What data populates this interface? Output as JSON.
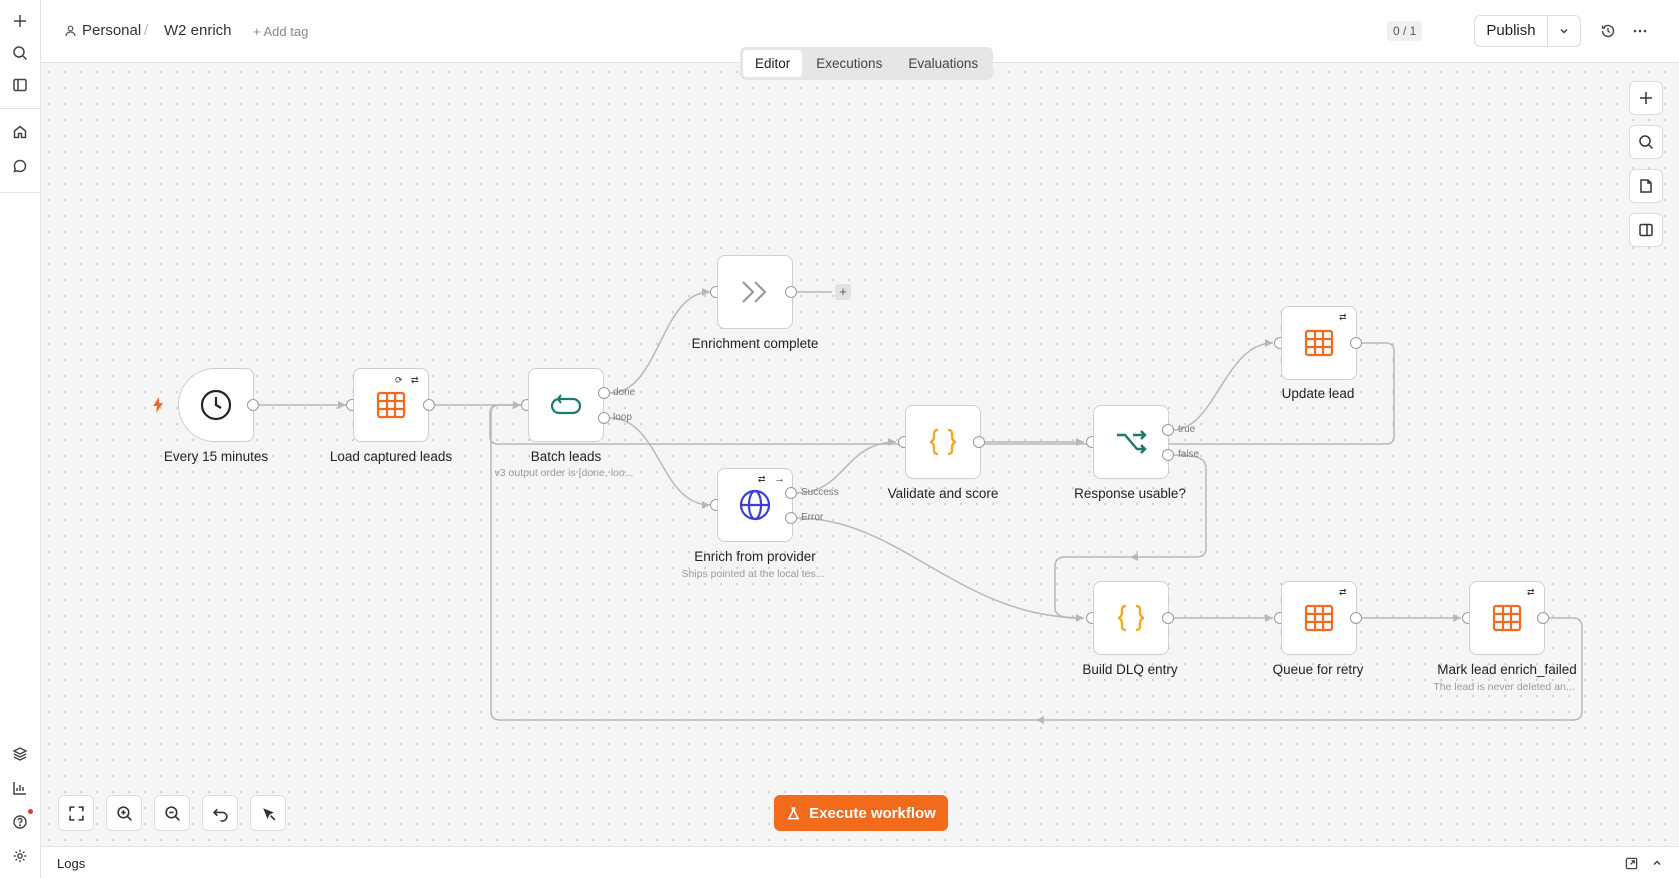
{
  "breadcrumb": {
    "project": "Personal",
    "separator": "/",
    "workflow": "W2 enrich",
    "add_tag": "+ Add tag"
  },
  "header": {
    "counter": "0 / 1",
    "publish": "Publish"
  },
  "tabs": [
    {
      "label": "Editor",
      "active": true
    },
    {
      "label": "Executions",
      "active": false
    },
    {
      "label": "Evaluations",
      "active": false
    }
  ],
  "nodes": {
    "every15": {
      "label": "Every 15 minutes",
      "icon": "clock-icon"
    },
    "load": {
      "label": "Load captured leads",
      "icon": "table-icon"
    },
    "batch": {
      "label": "Batch leads",
      "sub": "v3 output order is [done, loo...",
      "icon": "loop-icon",
      "port_done": "done",
      "port_loop": "loop"
    },
    "complete": {
      "label": "Enrichment complete",
      "icon": "no-op-icon"
    },
    "enrich": {
      "label": "Enrich from provider",
      "sub": "Ships pointed at the local tes...",
      "icon": "globe-icon",
      "port_success": "Success",
      "port_error": "Error"
    },
    "validate": {
      "label": "Validate and score",
      "icon": "code-braces-icon"
    },
    "usable": {
      "label": "Response usable?",
      "icon": "if-branch-icon",
      "port_true": "true",
      "port_false": "false"
    },
    "update": {
      "label": "Update lead",
      "icon": "table-icon"
    },
    "dlq": {
      "label": "Build DLQ entry",
      "icon": "code-braces-icon"
    },
    "retry": {
      "label": "Queue for retry",
      "icon": "table-icon"
    },
    "failed": {
      "label": "Mark lead enrich_failed",
      "sub": "The lead is never deleted an...",
      "icon": "table-icon"
    }
  },
  "controls": {
    "execute": "Execute workflow"
  },
  "logs": {
    "title": "Logs"
  },
  "colors": {
    "accent": "#f26b1d",
    "teal": "#1f7a6e",
    "blue": "#3b3fd8",
    "edge": "#b8b8b8"
  }
}
